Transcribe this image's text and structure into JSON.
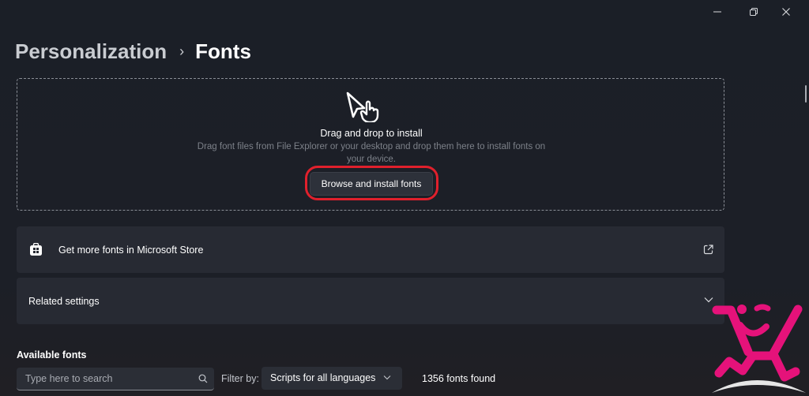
{
  "window": {
    "controls": [
      {
        "name": "minimize",
        "icon": "minimize-icon"
      },
      {
        "name": "maximize",
        "icon": "restore-icon"
      },
      {
        "name": "close",
        "icon": "close-icon"
      }
    ]
  },
  "breadcrumb": {
    "parent": "Personalization",
    "separator": "›",
    "current": "Fonts"
  },
  "dropzone": {
    "icon": "drag-drop-hand-icon",
    "title": "Drag and drop to install",
    "description": "Drag font files from File Explorer or your desktop and drop them here to install fonts on your device.",
    "browse_button": "Browse and install fonts",
    "highlight_color": "#e0202c"
  },
  "cards": {
    "store": {
      "icon": "microsoft-store-icon",
      "label": "Get more fonts in Microsoft Store",
      "trailing_icon": "open-external-icon"
    },
    "related": {
      "label": "Related settings",
      "trailing_icon": "chevron-down-icon"
    }
  },
  "available_fonts": {
    "title": "Available fonts",
    "search_placeholder": "Type here to search",
    "search_value": "",
    "filter_label": "Filter by:",
    "filter_value": "Scripts for all languages",
    "count_text": "1356 fonts found"
  },
  "overlay": {
    "mascot_icon": "jumping-figure-logo",
    "mascot_color": "#e5127a"
  }
}
